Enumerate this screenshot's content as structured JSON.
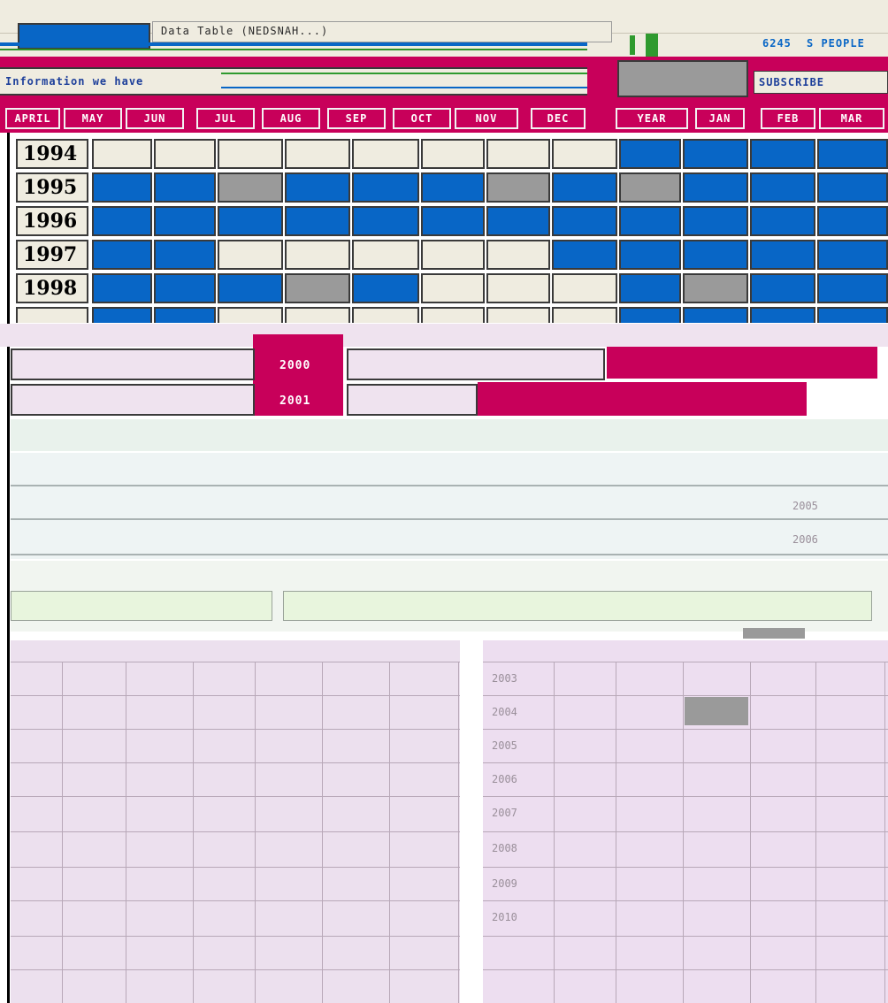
{
  "window": {
    "title": "Data Table (NEDSNAH...)",
    "right_labels": [
      "6245",
      "S PEOPLE"
    ]
  },
  "header": {
    "caption": "Information we have",
    "right_caption": "SUBSCRIBE"
  },
  "months": [
    "APRIL",
    "MAY",
    "JUN",
    "JUL",
    "AUG",
    "SEP",
    "OCT",
    "NOV",
    "DEC",
    "YEAR",
    "JAN",
    "FEB",
    "MAR"
  ],
  "grid": {
    "rows": [
      {
        "year": "1994",
        "cells": [
          "empty",
          "empty",
          "empty",
          "empty",
          "empty",
          "empty",
          "empty",
          "empty",
          "full",
          "full",
          "full",
          "full"
        ]
      },
      {
        "year": "1995",
        "cells": [
          "full",
          "full",
          "partial",
          "full",
          "full",
          "full",
          "partial",
          "full",
          "partial",
          "full",
          "full",
          "full"
        ]
      },
      {
        "year": "1996",
        "cells": [
          "full",
          "full",
          "full",
          "full",
          "full",
          "full",
          "full",
          "full",
          "full",
          "full",
          "full",
          "full"
        ]
      },
      {
        "year": "1997",
        "cells": [
          "full",
          "full",
          "empty",
          "empty",
          "empty",
          "empty",
          "empty",
          "full",
          "full",
          "full",
          "full",
          "full"
        ]
      },
      {
        "year": "1998",
        "cells": [
          "full",
          "full",
          "full",
          "partial",
          "full",
          "empty",
          "empty",
          "empty",
          "full",
          "partial",
          "full",
          "full"
        ]
      }
    ]
  },
  "lower": {
    "rows_a": [
      "2000",
      "2001"
    ],
    "rows_b": [
      "2005",
      "2006"
    ],
    "rows_c": [
      "2003",
      "2004",
      "2005",
      "2006",
      "2007",
      "2008",
      "2009",
      "2010"
    ]
  },
  "colors": {
    "full": "#0866c6",
    "partial": "#9a9a9a",
    "empty": "#efece0",
    "accent": "#c8005a"
  }
}
